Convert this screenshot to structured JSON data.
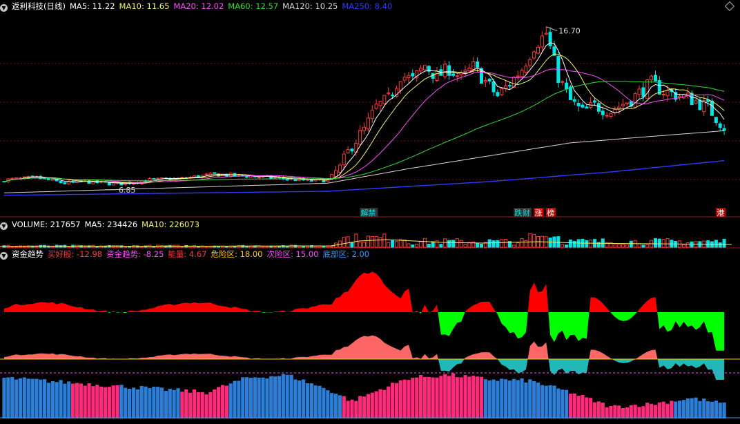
{
  "title": "返利科技(日线)",
  "colors": {
    "up": "#ff3b3b",
    "down": "#00e6e6",
    "ma5": "#ffffff",
    "ma10": "#f5f56a",
    "ma20": "#ff4dff",
    "ma60": "#33dd33",
    "ma120": "#d8d8d8",
    "ma250": "#2e3bff"
  },
  "price_legend": [
    {
      "label": "MA5: 11.22",
      "color": "#ffffff"
    },
    {
      "label": "MA10: 11.65",
      "color": "#f5f56a"
    },
    {
      "label": "MA20: 12.02",
      "color": "#ff4dff"
    },
    {
      "label": "MA60: 12.57",
      "color": "#33dd33"
    },
    {
      "label": "MA120: 10.25",
      "color": "#d8d8d8"
    },
    {
      "label": "MA250: 8.40",
      "color": "#2e3bff"
    }
  ],
  "volume_legend": [
    {
      "label": "VOLUME: 217657",
      "color": "#ffffff"
    },
    {
      "label": "MA5: 234426",
      "color": "#ffffff"
    },
    {
      "label": "MA10: 226073",
      "color": "#f5f56a"
    }
  ],
  "indicator_legend": [
    {
      "label": "资金趋势",
      "color": "#ffffff"
    },
    {
      "label": "买好股: -12.98",
      "color": "#ff3b3b"
    },
    {
      "label": "资金趋势: -8.25",
      "color": "#ff4dff"
    },
    {
      "label": "能量: 4.67",
      "color": "#ff3b3b"
    },
    {
      "label": "危险区: 18.00",
      "color": "#ffcc00"
    },
    {
      "label": "次险区: 15.00",
      "color": "#ff4dff"
    },
    {
      "label": "底部区: 2.00",
      "color": "#3399ff"
    }
  ],
  "markers": [
    {
      "label": "解禁",
      "index": 89,
      "fg": "#00e6e6",
      "bg": "#333333"
    },
    {
      "label": "跌",
      "index": 127,
      "fg": "#00e6e6",
      "bg": "#333333"
    },
    {
      "label": "财",
      "index": 129,
      "fg": "#00e6e6",
      "bg": "#333333"
    },
    {
      "label": "涨",
      "index": 132,
      "fg": "#ffffff",
      "bg": "#cc0000"
    },
    {
      "label": "榜",
      "index": 135,
      "fg": "#ffffff",
      "bg": "#cc0000"
    },
    {
      "label": "港",
      "index": 177,
      "fg": "#ffffff",
      "bg": "#cc0000"
    }
  ],
  "chart_data": {
    "type": "candlestick",
    "price_range": [
      5.6,
      17.5
    ],
    "max_label": "16.70",
    "min_label": "6.85",
    "close_anchors": [
      [
        0,
        7.2
      ],
      [
        8,
        7.35
      ],
      [
        15,
        7.0
      ],
      [
        20,
        7.1
      ],
      [
        28,
        6.95
      ],
      [
        36,
        7.2
      ],
      [
        44,
        7.3
      ],
      [
        52,
        7.55
      ],
      [
        60,
        7.45
      ],
      [
        68,
        7.3
      ],
      [
        76,
        7.15
      ],
      [
        80,
        7.2
      ],
      [
        83,
        7.9
      ],
      [
        86,
        9.4
      ],
      [
        89,
        10.3
      ],
      [
        92,
        11.7
      ],
      [
        95,
        12.2
      ],
      [
        98,
        13.7
      ],
      [
        101,
        13.4
      ],
      [
        104,
        14.3
      ],
      [
        107,
        13.6
      ],
      [
        110,
        14.1
      ],
      [
        113,
        13.5
      ],
      [
        116,
        14.2
      ],
      [
        119,
        13.3
      ],
      [
        122,
        12.4
      ],
      [
        125,
        13.2
      ],
      [
        128,
        14.1
      ],
      [
        131,
        15.5
      ],
      [
        134,
        16.3
      ],
      [
        137,
        13.6
      ],
      [
        140,
        12.1
      ],
      [
        143,
        11.4
      ],
      [
        146,
        11.8
      ],
      [
        150,
        11.5
      ],
      [
        155,
        12.2
      ],
      [
        160,
        13.2
      ],
      [
        163,
        12.7
      ],
      [
        166,
        12.5
      ],
      [
        170,
        12.2
      ],
      [
        174,
        11.7
      ],
      [
        178,
        10.5
      ]
    ],
    "ma120_anchors": [
      [
        0,
        6.4
      ],
      [
        80,
        7.0
      ],
      [
        100,
        7.9
      ],
      [
        120,
        8.7
      ],
      [
        140,
        9.5
      ],
      [
        160,
        9.9
      ],
      [
        178,
        10.25
      ]
    ],
    "ma250_anchors": [
      [
        0,
        6.25
      ],
      [
        80,
        6.5
      ],
      [
        120,
        7.1
      ],
      [
        150,
        7.7
      ],
      [
        178,
        8.4
      ]
    ],
    "indicator_range": [
      -7,
      7
    ],
    "bar_range": [
      0,
      16
    ],
    "levels": {
      "danger": 18.0,
      "secondary": 15.0,
      "bottom": 2.0
    }
  }
}
